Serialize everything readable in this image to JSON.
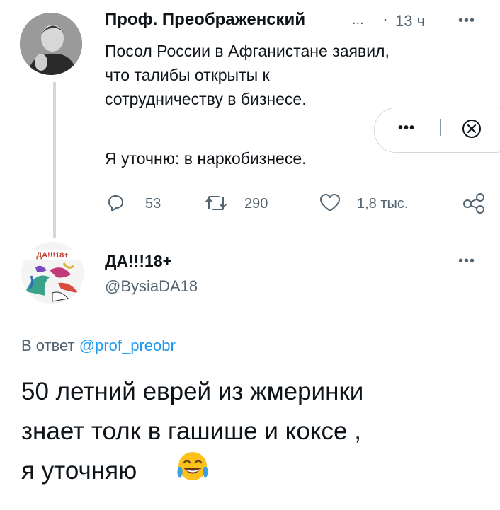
{
  "tweet": {
    "author_name": "Проф. Преображенский",
    "name_ellipsis": "...",
    "separator": "·",
    "time": "13 ч",
    "more_label": "•••",
    "text_line1": "Посол России в Афганистане заявил,",
    "text_line2": "что талибы открыты к",
    "text_line3": "сотрудничеству в бизнесе.",
    "text_line4": "Я уточню: в наркобизнесе.",
    "reply_count": "53",
    "retweet_count": "290",
    "like_count": "1,8 тыс.",
    "icons": [
      "reply-icon",
      "retweet-icon",
      "like-icon",
      "share-icon"
    ]
  },
  "popup": {
    "more_label": "•••"
  },
  "reply": {
    "author_name": "ДА!!!18+",
    "handle": "@BysiaDA18",
    "more_label": "•••",
    "in_reply_prefix": "В ответ",
    "in_reply_handle": "@prof_preobr",
    "avatar_text": "ДА!!!18+",
    "text_line1": "50 летний еврей из жмеринки",
    "text_line2": "знает толк в гашише и коксе ,",
    "text_line3": "я уточняю"
  },
  "colors": {
    "muted": "#536471",
    "link": "#1d9bf0",
    "line": "#cfd9de"
  }
}
